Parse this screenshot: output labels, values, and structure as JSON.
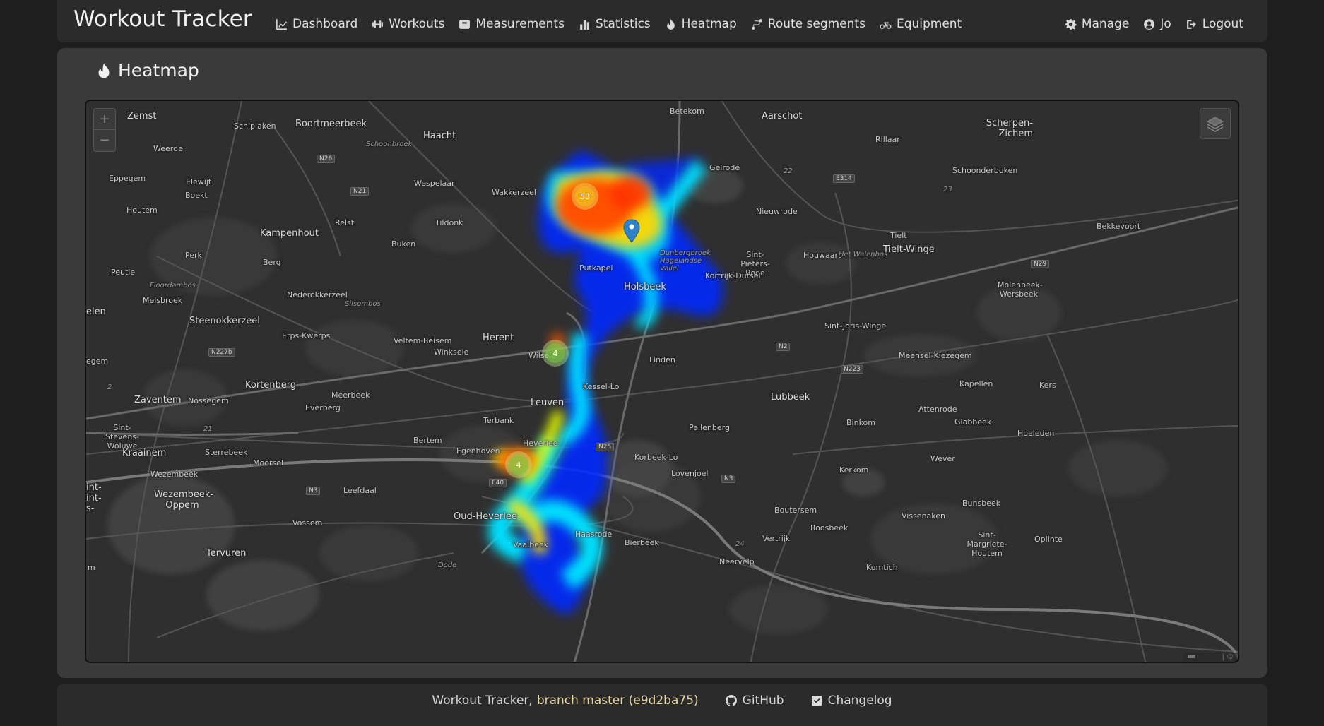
{
  "app": {
    "title": "Workout Tracker"
  },
  "nav": {
    "dashboard": "Dashboard",
    "workouts": "Workouts",
    "measurements": "Measurements",
    "statistics": "Statistics",
    "heatmap": "Heatmap",
    "route_segments": "Route segments",
    "equipment": "Equipment",
    "manage": "Manage",
    "user": "Jo",
    "logout": "Logout"
  },
  "page": {
    "title": "Heatmap"
  },
  "map": {
    "clusters": [
      {
        "count": "53",
        "color": "orange"
      },
      {
        "count": "4",
        "color": "green"
      },
      {
        "count": "4",
        "color": "green"
      }
    ],
    "labels": {
      "zemst": "Zemst",
      "boortmeerbeek": "Boortmeerbeek",
      "haacht": "Haacht",
      "betekom": "Betekom",
      "aarschot": "Aarschot",
      "scherpenheuvel": "Scherpen- Zichem",
      "schiplaken": "Schiplaken",
      "weerde": "Weerde",
      "schoonbroek": "Schoonbroek",
      "rillaar": "Rillaar",
      "gelrode": "Gelrode",
      "schoonderbuken": "Schoonderbuken",
      "eppegem": "Eppegem",
      "elewijt": "Elewijt",
      "boekt": "Boekt",
      "wespelaar": "Wespelaar",
      "wakkerzeel": "Wakkerzeel",
      "houtem": "Houtem",
      "relst": "Relst",
      "tildonk": "Tildonk",
      "nieuwrode": "Nieuwrode",
      "bekkevoort": "Bekkevoort",
      "kampenhout": "Kampenhout",
      "buken": "Buken",
      "tielt": "Tielt",
      "perk": "Perk",
      "berg": "Berg",
      "sint_pieters_rode": "Sint-Pieters- Rode",
      "houwaart": "Houwaart",
      "walenbos": "Het Walenbos",
      "tielt_winge": "Tielt-Winge",
      "peutie": "Peutie",
      "putkapel": "Putkapel",
      "dunbergbroek": "Dunbergbroek Hagelandse Vallei",
      "kortrijk_dutsel": "Kortrijk-Dutsel",
      "floordambos": "Floordambos",
      "holsbeek": "Holsbeek",
      "molenbeek_wersbeek": "Molenbeek- Wersbeek",
      "melsbroek": "Melsbroek",
      "nederokkerzeel": "Nederokkerzeel",
      "silsombos": "Silsombos",
      "elen": "elen",
      "steenokkerzeel": "Steenokkerzeel",
      "sint_joris_winge": "Sint-Joris-Winge",
      "erps_kwerps": "Erps-Kwerps",
      "veltem_beisem": "Veltem-Beisem",
      "herent": "Herent",
      "winksele": "Winksele",
      "wilsele": "Wilsele",
      "linden": "Linden",
      "meensel_kiezegem": "Meensel-Kiezegem",
      "egem": "egem",
      "kortenberg": "Kortenberg",
      "kessel_lo": "Kessel-Lo",
      "lubbeek": "Lubbeek",
      "kapellen": "Kapellen",
      "kers": "Kers",
      "zaventem": "Zaventem",
      "nossegem": "Nossegem",
      "meerbeek": "Meerbeek",
      "everberg": "Everberg",
      "leuven": "Leuven",
      "attenrode": "Attenrode",
      "terbank": "Terbank",
      "pellenberg": "Pellenberg",
      "binkom": "Binkom",
      "glabbeek": "Glabbeek",
      "hoeleden": "Hoeleden",
      "sint_stevens_woluwe": "Sint-Stevens- Woluwe",
      "bertem": "Bertem",
      "heverlee": "Heverlee",
      "egenhoven": "Egenhoven",
      "korbeek_lo": "Korbeek-Lo",
      "wever": "Wever",
      "kraainem": "Kraainem",
      "sterrebeek": "Sterrebeek",
      "moorsel": "Moorsel",
      "lovenjoel": "Lovenjoel",
      "kerkom": "Kerkom",
      "wezembeek": "Wezembeek",
      "leefdaal": "Leefdaal",
      "wezembeek_oppem": "Wezembeek- Oppem",
      "bunsbeek": "Bunsbeek",
      "boutersem": "Boutersem",
      "oud_heverlee": "Oud-Heverlee",
      "vissenaken": "Vissenaken",
      "vossem": "Vossem",
      "roosbeek": "Roosbeek",
      "haasrode": "Haasrode",
      "vertrijk": "Vertrijk",
      "sint_margriete_houtem": "Sint-Margriete- Houtem",
      "oplinter": "Oplinte",
      "vaalbeek": "Vaalbeek",
      "bierbeek": "Bierbeek",
      "tervuren": "Tervuren",
      "neervelp": "Neervelp",
      "kumtich": "Kumtich",
      "dode": "Dode",
      "int": "int- int- s-",
      "m": "m"
    },
    "roads": {
      "n26": "N26",
      "n21": "N21",
      "e314": "E314",
      "n29": "N29",
      "n2": "N2",
      "n223": "N223",
      "n227b": "N227b",
      "n25": "N25",
      "e40": "E40",
      "n3a": "N3",
      "n3b": "N3",
      "n22": "22",
      "n21b": "21",
      "n23": "23",
      "n24": "24",
      "n2b": "2"
    },
    "attribution": "| ©"
  },
  "footer": {
    "prefix": "Workout Tracker, ",
    "branch": "branch master (e9d2ba75)",
    "github": "GitHub",
    "changelog": "Changelog"
  },
  "colors": {
    "background": "#1e1e1e",
    "navbar": "#2b2b2b",
    "panel": "#3a3a3a",
    "map": "#2f2f2f"
  }
}
